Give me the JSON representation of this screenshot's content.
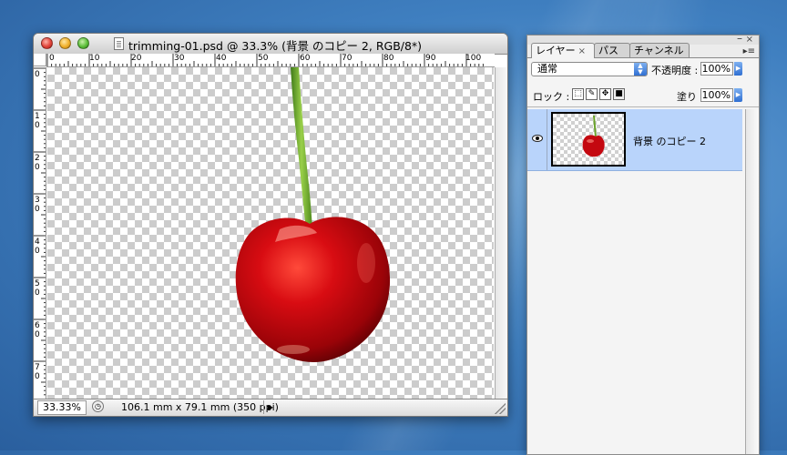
{
  "document_window": {
    "title": "trimming-01.psd @ 33.3% (背景 のコピー 2, RGB/8*)",
    "ruler_top_labels": [
      "0",
      "10",
      "20",
      "30",
      "40",
      "50",
      "60",
      "70",
      "80",
      "90",
      "100"
    ],
    "ruler_left_labels": [
      "0",
      "1",
      "2",
      "3",
      "4",
      "5",
      "6",
      "7"
    ],
    "ruler_left_zero": "0",
    "status": {
      "zoom": "33.33%",
      "info": "106.1 mm x 79.1 mm (350 ppi)"
    }
  },
  "layers_palette": {
    "tabs": [
      {
        "label": "レイヤー",
        "close": "×"
      },
      {
        "label": "パス"
      },
      {
        "label": "チャンネル"
      }
    ],
    "blend_mode": "通常",
    "opacity_label": "不透明度 :",
    "opacity_value": "100%",
    "lock_label": "ロック :",
    "fill_label": "塗り :",
    "fill_value": "100%",
    "layers": [
      {
        "name": "背景 のコピー 2",
        "visible": true,
        "selected": true
      }
    ]
  },
  "colors": {
    "selection": "#b9d4fb",
    "cherry": "#c40810",
    "stem": "#6aa22a"
  }
}
